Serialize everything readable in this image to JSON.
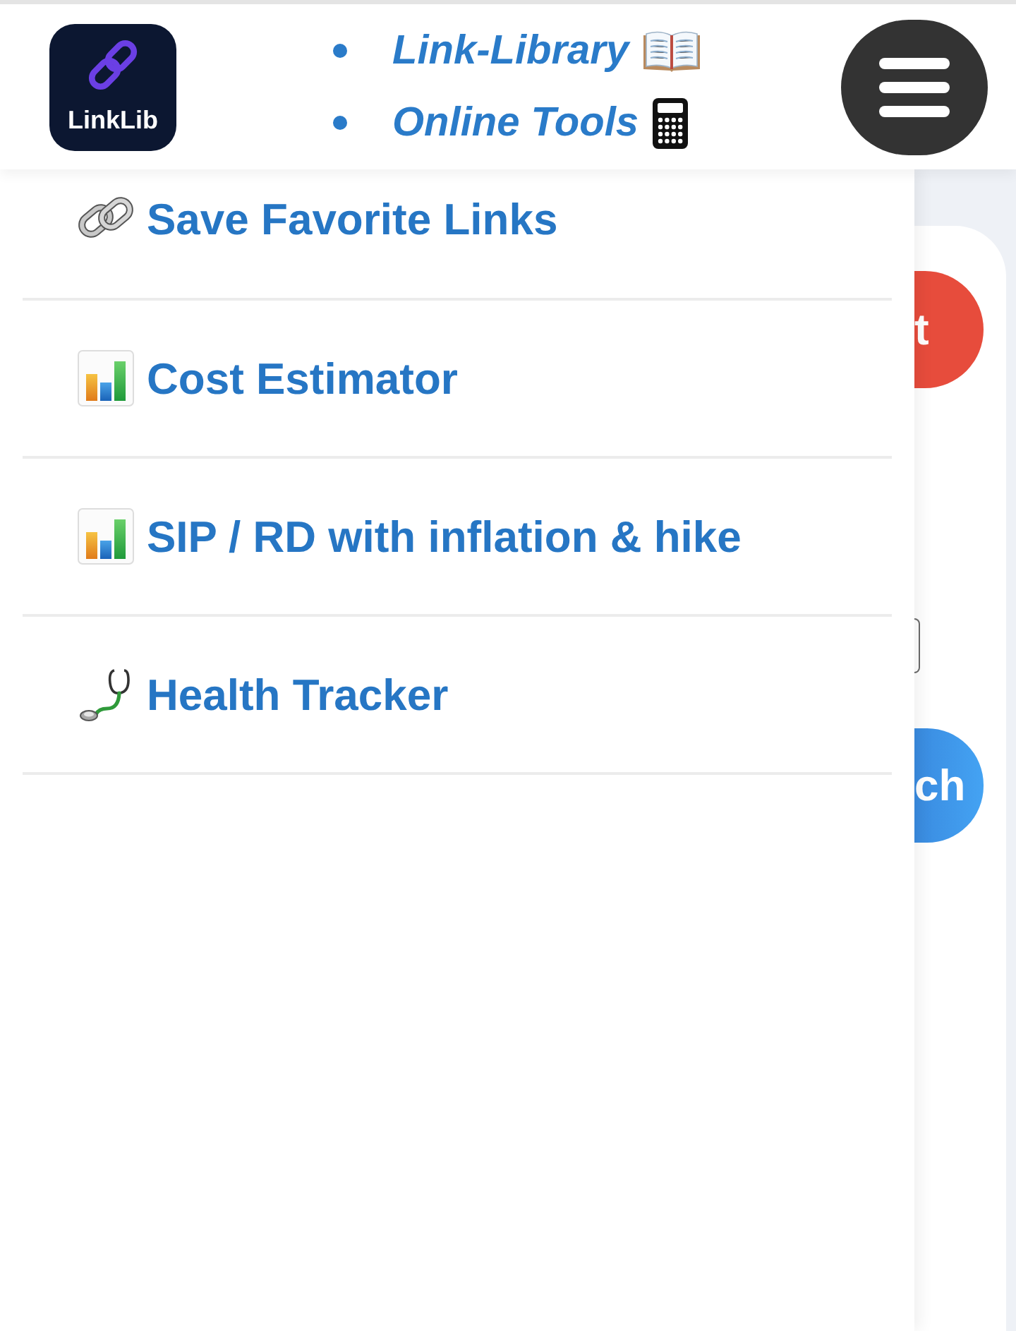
{
  "header": {
    "logo": {
      "text": "LinkLib"
    },
    "nav_links": [
      {
        "label": "Link-Library",
        "kind": "library"
      },
      {
        "label": "Online Tools",
        "kind": "tools"
      }
    ]
  },
  "drawer": {
    "open": true,
    "items": [
      {
        "label": "Save Favorite Links",
        "kind": "links"
      },
      {
        "label": "Cost Estimator",
        "kind": "chart"
      },
      {
        "label": "SIP / RD with inflation & hike",
        "kind": "chart"
      },
      {
        "label": "Health Tracker",
        "kind": "health"
      }
    ]
  },
  "background_page": {
    "controls": [
      {
        "kind": "danger",
        "label": "t"
      },
      {
        "kind": "field"
      },
      {
        "kind": "primary",
        "label": "ch"
      }
    ]
  }
}
